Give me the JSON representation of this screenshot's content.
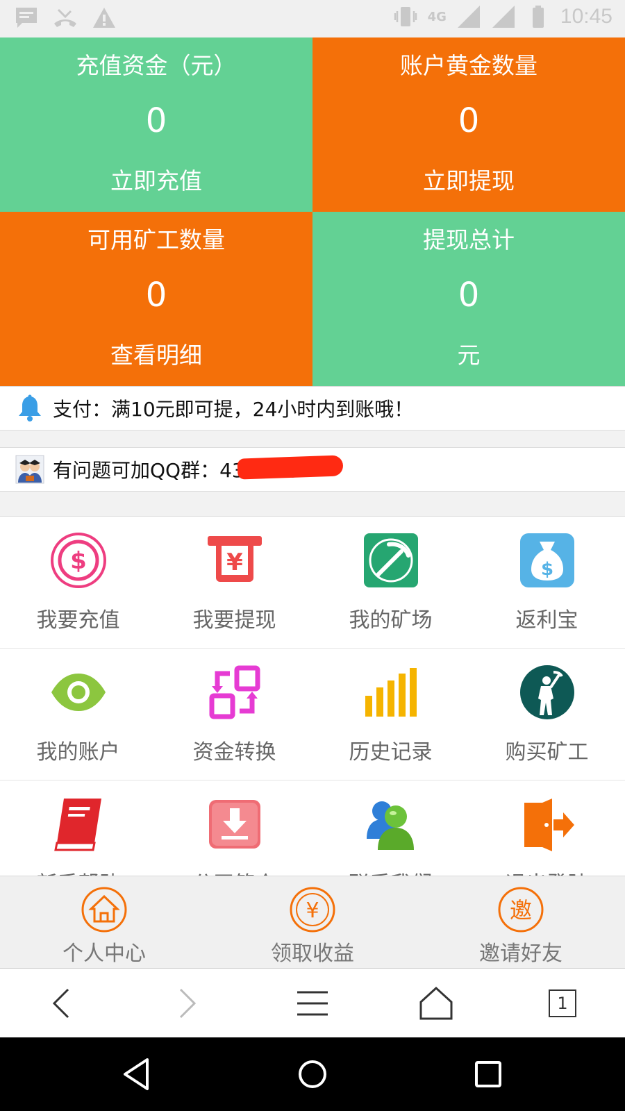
{
  "status_bar": {
    "time": "10:45",
    "network": "4G",
    "icons": [
      "message-icon",
      "missed-call-icon",
      "warning-icon",
      "vibrate-icon",
      "signal-icon",
      "signal-icon",
      "battery-icon"
    ]
  },
  "stats": [
    {
      "title": "充值资金（元）",
      "value": "0",
      "action": "立即充值",
      "color": "#63d194"
    },
    {
      "title": "账户黄金数量",
      "value": "0",
      "action": "立即提现",
      "color": "#f47009"
    },
    {
      "title": "可用矿工数量",
      "value": "0",
      "action": "查看明细",
      "color": "#f47009"
    },
    {
      "title": "提现总计",
      "value": "0",
      "action": "元",
      "color": "#63d194"
    }
  ],
  "notices": [
    {
      "icon": "bell-icon",
      "text": "支付：满10元即可提，24小时内到账哦！"
    },
    {
      "icon": "group-avatar-icon",
      "text": "有问题可加QQ群：43        1453."
    }
  ],
  "functions": [
    {
      "label": "我要充值",
      "icon": "dollar-circle-icon"
    },
    {
      "label": "我要提现",
      "icon": "atm-yuan-icon"
    },
    {
      "label": "我的矿场",
      "icon": "pickaxe-icon"
    },
    {
      "label": "返利宝",
      "icon": "money-bag-icon"
    },
    {
      "label": "我的账户",
      "icon": "eye-icon"
    },
    {
      "label": "资金转换",
      "icon": "exchange-icon"
    },
    {
      "label": "历史记录",
      "icon": "bar-chart-icon"
    },
    {
      "label": "购买矿工",
      "icon": "miner-icon"
    },
    {
      "label": "新手帮助",
      "icon": "book-icon"
    },
    {
      "label": "公司简介",
      "icon": "download-icon"
    },
    {
      "label": "联系我们",
      "icon": "contacts-icon"
    },
    {
      "label": "退出登陆",
      "icon": "logout-icon"
    }
  ],
  "tabs": [
    {
      "label": "个人中心",
      "icon": "home-icon"
    },
    {
      "label": "领取收益",
      "icon": "yuan-icon"
    },
    {
      "label": "邀请好友",
      "icon": "invite-icon",
      "glyph": "邀"
    }
  ],
  "tab_yuan_glyph": "¥",
  "browser": {
    "tab_count": "1"
  },
  "accent": "#f47009",
  "green": "#63d194"
}
